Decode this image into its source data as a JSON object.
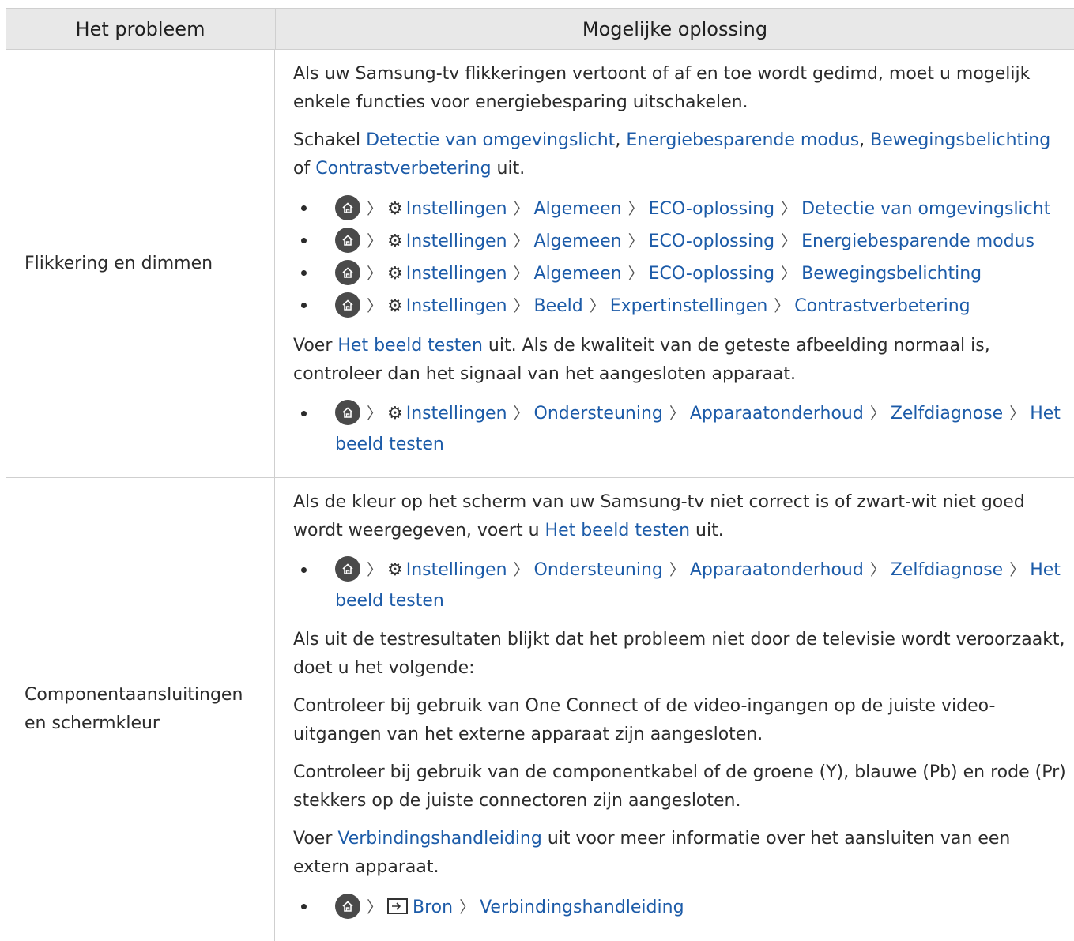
{
  "header": {
    "col1": "Het probleem",
    "col2": "Mogelijke oplossing"
  },
  "icons": {
    "home": "home-icon",
    "settings": "gear-icon",
    "source": "source-input-icon",
    "separator": "chevron-right-icon"
  },
  "rows": [
    {
      "problem": "Flikkering en dimmen",
      "p1": "Als uw Samsung-tv flikkeringen vertoont of af en toe wordt gedimd, moet u mogelijk enkele functies voor energiebesparing uitschakelen.",
      "p2": {
        "prefix": "Schakel ",
        "l1": "Detectie van omgevingslicht",
        "sep1": ", ",
        "l2": "Energiebesparende modus",
        "sep2": ", ",
        "l3": "Bewegingsbelichting",
        "sep3": " of ",
        "l4": "Contrastverbetering",
        "suffix": " uit."
      },
      "paths1": [
        [
          "Instellingen",
          "Algemeen",
          "ECO-oplossing",
          "Detectie van omgevingslicht"
        ],
        [
          "Instellingen",
          "Algemeen",
          "ECO-oplossing",
          "Energiebesparende modus"
        ],
        [
          "Instellingen",
          "Algemeen",
          "ECO-oplossing",
          "Bewegingsbelichting"
        ],
        [
          "Instellingen",
          "Beeld",
          "Expertinstellingen",
          "Contrastverbetering"
        ]
      ],
      "p3": {
        "prefix": "Voer ",
        "link": "Het beeld testen",
        "suffix": " uit. Als de kwaliteit van de geteste afbeelding normaal is, controleer dan het signaal van het aangesloten apparaat."
      },
      "path2": [
        "Instellingen",
        "Ondersteuning",
        "Apparaatonderhoud",
        "Zelfdiagnose",
        "Het beeld testen"
      ]
    },
    {
      "problem": "Componentaansluitingen en schermkleur",
      "p1": {
        "prefix": "Als de kleur op het scherm van uw Samsung-tv niet correct is of zwart-wit niet goed wordt weergegeven, voert u ",
        "link": "Het beeld testen",
        "suffix": " uit."
      },
      "path1": [
        "Instellingen",
        "Ondersteuning",
        "Apparaatonderhoud",
        "Zelfdiagnose",
        "Het beeld testen"
      ],
      "p2": "Als uit de testresultaten blijkt dat het probleem niet door de televisie wordt veroorzaakt, doet u het volgende:",
      "p3": "Controleer bij gebruik van One Connect of de video-ingangen op de juiste video-uitgangen van het externe apparaat zijn aangesloten.",
      "p4": "Controleer bij gebruik van de componentkabel of de groene (Y), blauwe (Pb) en rode (Pr) stekkers op de juiste connectoren zijn aangesloten.",
      "p5": {
        "prefix": "Voer ",
        "link": "Verbindingshandleiding",
        "suffix": " uit voor meer informatie over het aansluiten van een extern apparaat."
      },
      "path2": [
        "Bron",
        "Verbindingshandleiding"
      ]
    }
  ]
}
